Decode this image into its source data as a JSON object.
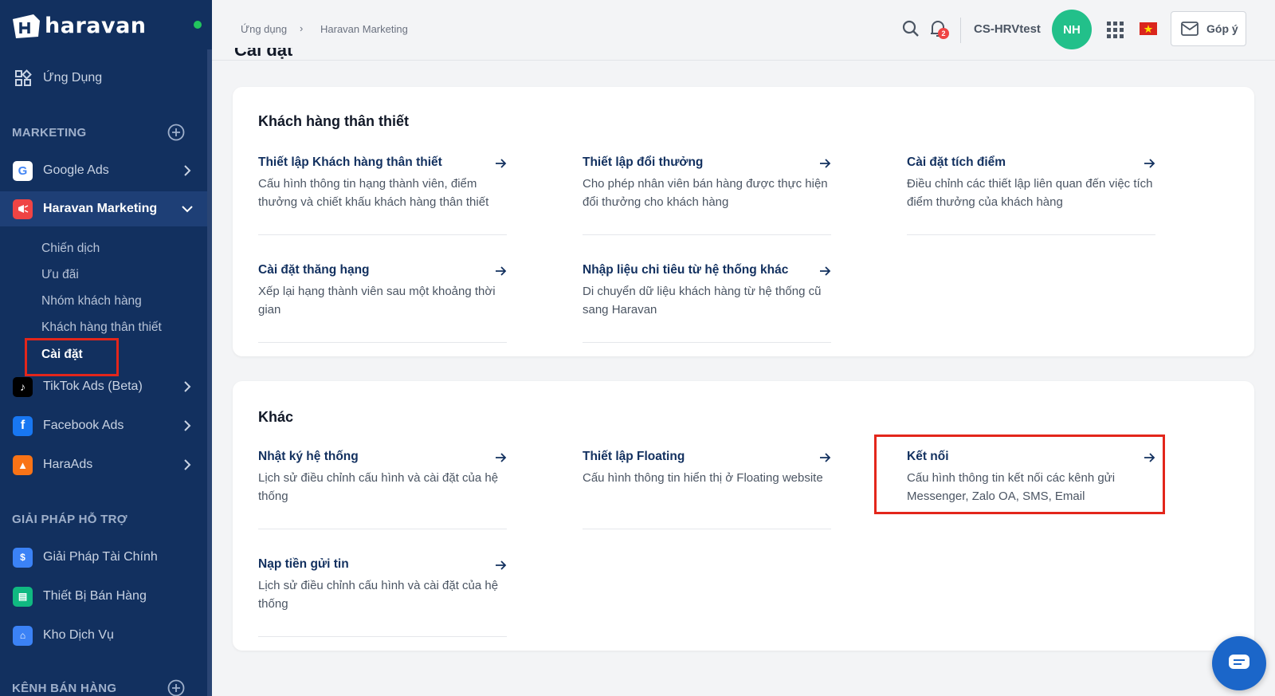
{
  "brand": {
    "name": "haravan"
  },
  "sidebar": {
    "apps_label": "Ứng Dụng",
    "marketing_section": "MARKETING",
    "items": [
      {
        "label": "Google Ads"
      },
      {
        "label": "Haravan Marketing"
      }
    ],
    "sub_items": [
      "Chiến dịch",
      "Ưu đãi",
      "Nhóm khách hàng",
      "Khách hàng thân thiết",
      "Cài đặt"
    ],
    "more_items": [
      {
        "label": "TikTok Ads (Beta)"
      },
      {
        "label": "Facebook Ads"
      },
      {
        "label": "HaraAds"
      }
    ],
    "support_section": "GIẢI PHÁP HỖ TRỢ",
    "support_items": [
      {
        "label": "Giải Pháp Tài Chính"
      },
      {
        "label": "Thiết Bị Bán Hàng"
      },
      {
        "label": "Kho Dịch Vụ"
      }
    ],
    "sales_section": "KÊNH BÁN HÀNG"
  },
  "header": {
    "breadcrumb": [
      "Ứng dụng",
      "Haravan Marketing"
    ],
    "notification_count": "2",
    "store_name": "CS-HRVtest",
    "avatar_initials": "NH",
    "feedback_label": "Góp ý"
  },
  "page": {
    "title": "Cài đặt"
  },
  "loyalty": {
    "title": "Khách hàng thân thiết",
    "settings": [
      {
        "title": "Thiết lập Khách hàng thân thiết",
        "desc": "Cấu hình thông tin hạng thành viên, điểm thưởng và chiết khấu khách hàng thân thiết"
      },
      {
        "title": "Thiết lập đổi thưởng",
        "desc": "Cho phép nhân viên bán hàng được thực hiện đổi thưởng cho khách hàng"
      },
      {
        "title": "Cài đặt tích điểm",
        "desc": "Điều chỉnh các thiết lập liên quan đến việc tích điểm thưởng của khách hàng"
      },
      {
        "title": "Cài đặt thăng hạng",
        "desc": "Xếp lại hạng thành viên sau một khoảng thời gian"
      },
      {
        "title": "Nhập liệu chi tiêu từ hệ thống khác",
        "desc": "Di chuyển dữ liệu khách hàng từ hệ thống cũ sang Haravan"
      }
    ]
  },
  "other": {
    "title": "Khác",
    "settings": [
      {
        "title": "Nhật ký hệ thống",
        "desc": "Lịch sử điều chỉnh cấu hình và cài đặt của hệ thống"
      },
      {
        "title": "Thiết lập Floating",
        "desc": "Cấu hình thông tin hiển thị ở Floating website"
      },
      {
        "title": "Kết nối",
        "desc": "Cấu hình thông tin kết nối các kênh gửi Messenger, Zalo OA, SMS, Email"
      },
      {
        "title": "Nạp tiền gửi tin",
        "desc": "Lịch sử điều chỉnh cấu hình và cài đặt của hệ thống"
      }
    ]
  },
  "colors": {
    "sidebar_bg": "#12305f",
    "accent_navy": "#12305f",
    "highlight_red": "#e3261b",
    "avatar_green": "#22c08a"
  }
}
